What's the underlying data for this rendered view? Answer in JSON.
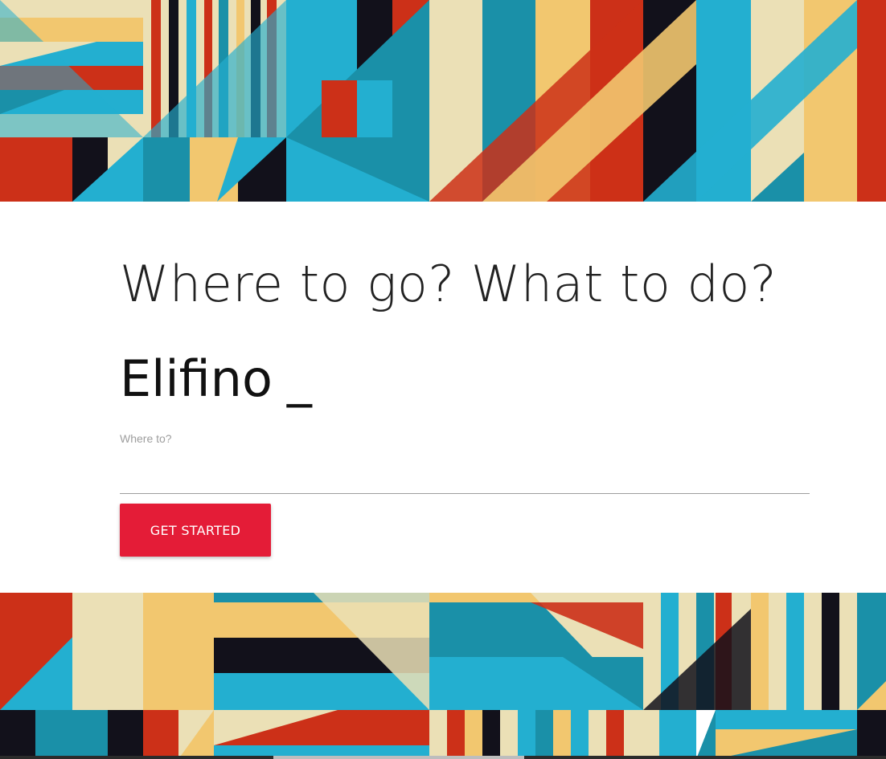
{
  "hero": {
    "heading": "Where to go? What to do?",
    "typed_text": "Elifino",
    "typed_cursor": "_"
  },
  "search": {
    "label": "Where to?",
    "value": "",
    "placeholder": ""
  },
  "cta": {
    "label": "GET STARTED"
  },
  "colors": {
    "accent": "#e41c37",
    "red": "#cc3018",
    "cream": "#ebe0b6",
    "gold": "#f2c76f",
    "teal": "#1a90a8",
    "sky": "#23afd0",
    "ink": "#12111b"
  }
}
